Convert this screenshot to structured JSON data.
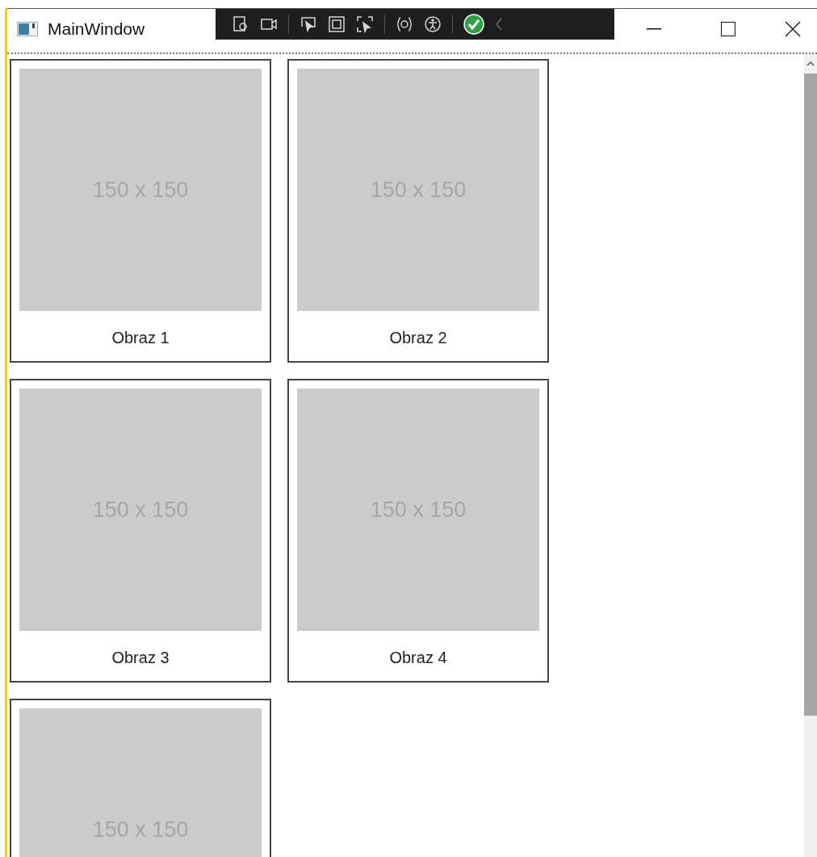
{
  "window": {
    "title": "MainWindow"
  },
  "cards": [
    {
      "image_text": "150 x 150",
      "label": "Obraz 1"
    },
    {
      "image_text": "150 x 150",
      "label": "Obraz 2"
    },
    {
      "image_text": "150 x 150",
      "label": "Obraz 3"
    },
    {
      "image_text": "150 x 150",
      "label": "Obraz 4"
    },
    {
      "image_text": "150 x 150"
    }
  ]
}
